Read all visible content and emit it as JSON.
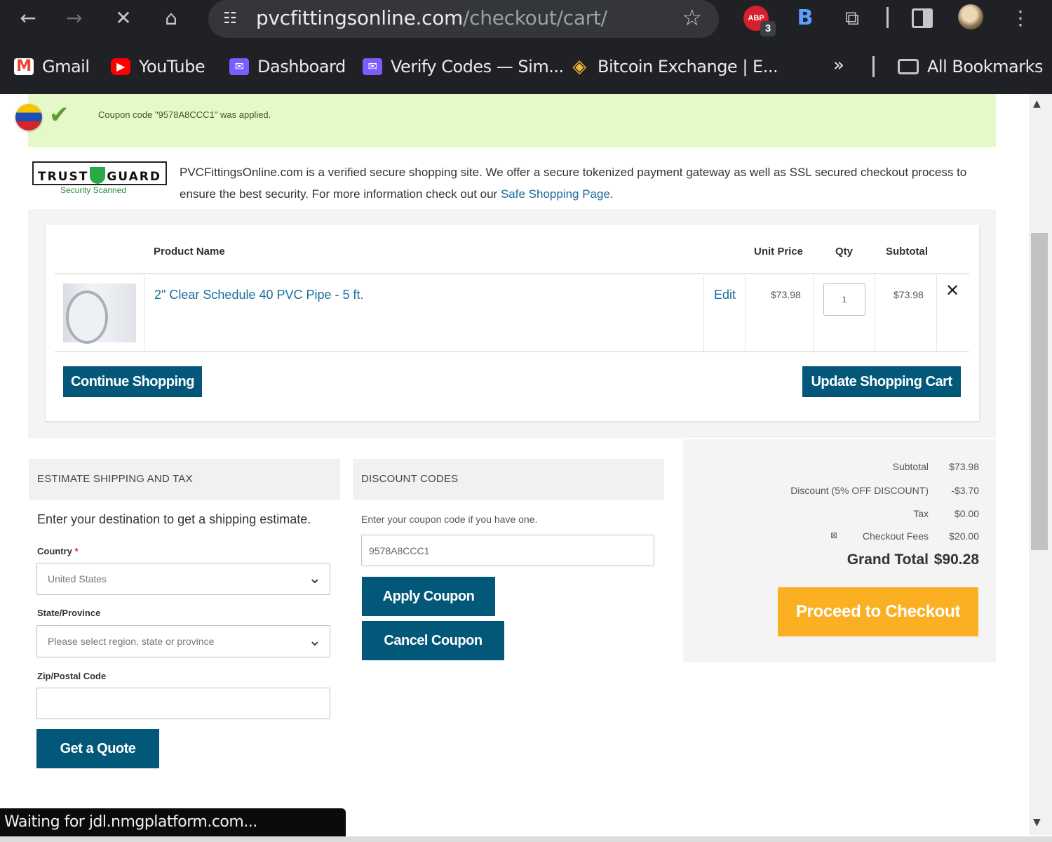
{
  "browser": {
    "url_host": "pvcfittingsonline.com",
    "url_path": "/checkout/cart/",
    "abp_label": "ABP",
    "abp_badge": "3",
    "bitwarden_label": "B",
    "bookmarks": [
      {
        "label": "Gmail",
        "icon": "gmail-icon"
      },
      {
        "label": "YouTube",
        "icon": "youtube-icon"
      },
      {
        "label": "Dashboard",
        "icon": "mail-icon"
      },
      {
        "label": "Verify Codes — Sim...",
        "icon": "mail-icon"
      },
      {
        "label": "Bitcoin Exchange | E...",
        "icon": "binance-icon"
      }
    ],
    "more_label": "»",
    "all_bookmarks_label": "All Bookmarks",
    "status_text": "Waiting for jdl.nmgplatform.com..."
  },
  "notice": {
    "coupon_message": "Coupon code \"9578A8CCC1\" was applied."
  },
  "trust": {
    "logo_left": "TRUST",
    "logo_right": "GUARD",
    "subtitle": "Security Scanned",
    "text": "PVCFittingsOnline.com is a verified secure shopping site. We offer a secure tokenized payment gateway as well as SSL secured checkout process to ensure the best security. For more information check out our ",
    "link": "Safe Shopping Page",
    "end": "."
  },
  "cart": {
    "headers": {
      "product": "Product Name",
      "unit_price": "Unit Price",
      "qty": "Qty",
      "subtotal": "Subtotal"
    },
    "items": [
      {
        "name": "2\" Clear Schedule 40 PVC Pipe - 5 ft.",
        "edit": "Edit",
        "unit_price": "$73.98",
        "qty": "1",
        "subtotal": "$73.98"
      }
    ],
    "continue_label": "Continue Shopping",
    "update_label": "Update Shopping Cart"
  },
  "shipping": {
    "title": "ESTIMATE SHIPPING AND TAX",
    "intro": "Enter your destination to get a shipping estimate.",
    "country_label": "Country",
    "required_mark": "*",
    "country_value": "United States",
    "state_label": "State/Province",
    "state_placeholder": "Please select region, state or province",
    "zip_label": "Zip/Postal Code",
    "zip_value": "",
    "quote_label": "Get a Quote"
  },
  "discount": {
    "title": "DISCOUNT CODES",
    "intro": "Enter your coupon code if you have one.",
    "code_value": "9578A8CCC1",
    "apply_label": "Apply Coupon",
    "cancel_label": "Cancel Coupon"
  },
  "totals": {
    "subtotal_label": "Subtotal",
    "subtotal_value": "$73.98",
    "discount_label": "Discount (5% OFF DISCOUNT)",
    "discount_value": "-$3.70",
    "tax_label": "Tax",
    "tax_value": "$0.00",
    "fees_label": "Checkout Fees",
    "fees_value": "$20.00",
    "grand_label": "Grand Total",
    "grand_value": "$90.28",
    "checkout_label": "Proceed to Checkout"
  },
  "colors": {
    "brand_blue": "#03587a",
    "checkout_orange": "#fbb024",
    "success_green": "#e5f8c8",
    "link_blue": "#1a6c9b"
  }
}
